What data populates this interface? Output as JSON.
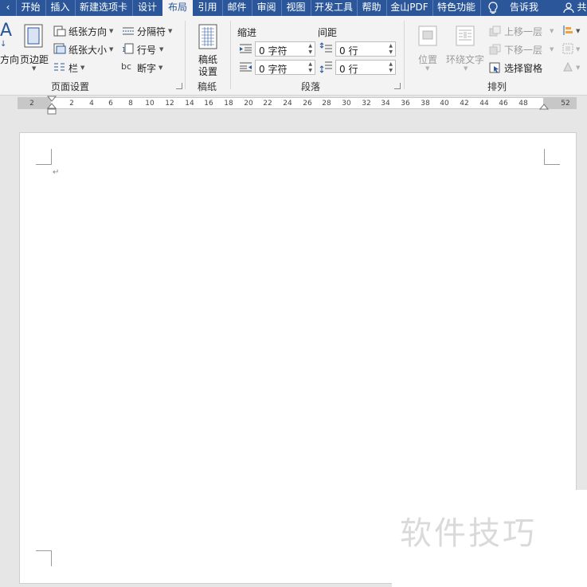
{
  "tabs": [
    "开始",
    "插入",
    "新建选项卡",
    "设计",
    "布局",
    "引用",
    "邮件",
    "审阅",
    "视图",
    "开发工具",
    "帮助",
    "金山PDF",
    "特色功能"
  ],
  "active_tab": "布局",
  "tell_me": "告诉我",
  "share_partial": "共",
  "page_setup": {
    "direction_partial": "方向",
    "margins": "页边距",
    "orientation": "纸张方向",
    "size": "纸张大小",
    "columns": "栏",
    "breaks": "分隔符",
    "line_numbers": "行号",
    "hyphenation": "断字",
    "group_label": "页面设置"
  },
  "manuscript": {
    "button_line1": "稿纸",
    "button_line2": "设置",
    "group_label": "稿纸"
  },
  "paragraph": {
    "indent_title": "缩进",
    "spacing_title": "间距",
    "indent_left": "0 字符",
    "indent_right": "0 字符",
    "spacing_before": "0 行",
    "spacing_after": "0 行",
    "group_label": "段落"
  },
  "arrange": {
    "position": "位置",
    "wrap_text": "环绕文字",
    "bring_forward": "上移一层",
    "send_backward": "下移一层",
    "selection_pane": "选择窗格",
    "group_label": "排列"
  },
  "ruler": {
    "ticks": [
      "2",
      "2",
      "4",
      "6",
      "8",
      "10",
      "12",
      "14",
      "16",
      "18",
      "20",
      "22",
      "24",
      "26",
      "28",
      "30",
      "32",
      "34",
      "36",
      "38",
      "40",
      "42",
      "44",
      "46",
      "48",
      "52"
    ]
  },
  "document": {
    "paragraph_mark": "↵"
  },
  "watermark": "软件技巧"
}
